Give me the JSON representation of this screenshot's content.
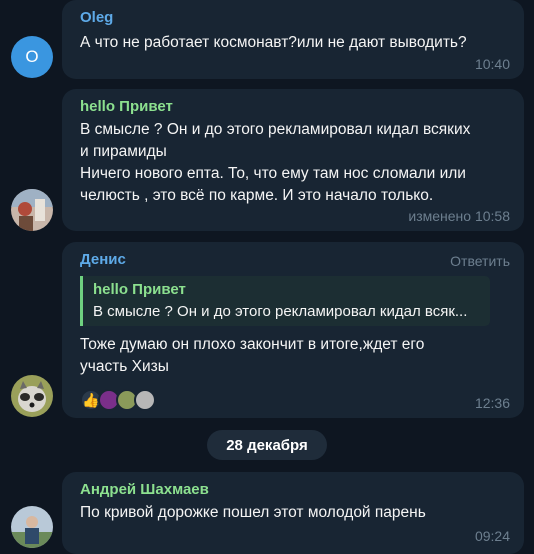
{
  "colors": {
    "background": "#0e1621",
    "bubble": "#182533",
    "meta": "#6d7f8f",
    "name_oleg": "#5eaae8",
    "name_green": "#8ce08f",
    "name_denis": "#5eaae8"
  },
  "messages": [
    {
      "sender": "Oleg",
      "avatar_letter": "O",
      "lines": [
        "А что не работает космонавт?или не дают выводить?"
      ],
      "time": "10:40"
    },
    {
      "sender": "hello Привет",
      "avatar_icon": "user-photo-avatar",
      "lines": [
        "В смысле ? Он и до этого рекламировал кидал всяких",
        "и пирамиды",
        "Ничего нового епта. То, что ему там нос сломали или",
        "челюсть , это всё по карме. И это начало только."
      ],
      "time": "изменено 10:58"
    },
    {
      "sender": "Денис",
      "avatar_icon": "raccoon-avatar",
      "reply_action": "Ответить",
      "quote": {
        "name": "hello Привет",
        "text": "В смысле ? Он и до этого рекламировал кидал всяк..."
      },
      "lines": [
        "Тоже думаю он плохо закончит в итоге,ждет его",
        "участь Хизы"
      ],
      "reactions": [
        "thumbs-up-emoji",
        "reactor-avatar-1",
        "reactor-avatar-2",
        "reactor-avatar-3"
      ],
      "time": "12:36"
    },
    {
      "sender": "Андрей Шахмаев",
      "avatar_icon": "person-photo-avatar",
      "lines": [
        "По кривой дорожке пошел этот молодой парень"
      ],
      "time": "09:24"
    }
  ],
  "date_separator": "28 декабря"
}
